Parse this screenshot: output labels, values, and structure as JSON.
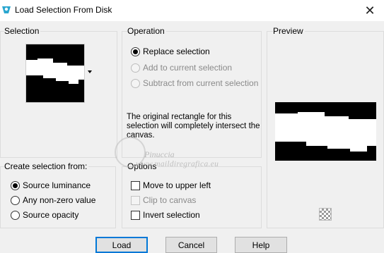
{
  "window": {
    "title": "Load Selection From Disk",
    "close_glyph": "✕"
  },
  "selection": {
    "label": "Selection"
  },
  "operation": {
    "label": "Operation",
    "options": [
      {
        "label": "Replace selection",
        "checked": true,
        "enabled": true
      },
      {
        "label": "Add to current selection",
        "checked": false,
        "enabled": false
      },
      {
        "label": "Subtract from current selection",
        "checked": false,
        "enabled": false
      }
    ],
    "info": "The original rectangle for this selection will completely intersect the canvas."
  },
  "preview": {
    "label": "Preview"
  },
  "create_from": {
    "label": "Create selection from:",
    "options": [
      {
        "label": "Source luminance",
        "checked": true
      },
      {
        "label": "Any non-zero value",
        "checked": false
      },
      {
        "label": "Source opacity",
        "checked": false
      }
    ]
  },
  "options": {
    "label": "Options",
    "items": [
      {
        "label": "Move to upper left",
        "checked": false,
        "enabled": true
      },
      {
        "label": "Clip to canvas",
        "checked": false,
        "enabled": false
      },
      {
        "label": "Invert selection",
        "checked": false,
        "enabled": true
      }
    ]
  },
  "watermark": {
    "name": "Pinuccia",
    "url": "www.maildiregrafica.eu"
  },
  "buttons": {
    "load": "Load",
    "cancel": "Cancel",
    "help": "Help"
  },
  "colors": {
    "accent": "#0078d7",
    "window_bg": "#f0f0f0",
    "titlebar_bg": "#ffffff"
  },
  "icons": {
    "app": "app-icon",
    "close": "close-icon",
    "dropdown": "chevron-down-icon",
    "preview_toggle": "checkerboard-icon"
  }
}
